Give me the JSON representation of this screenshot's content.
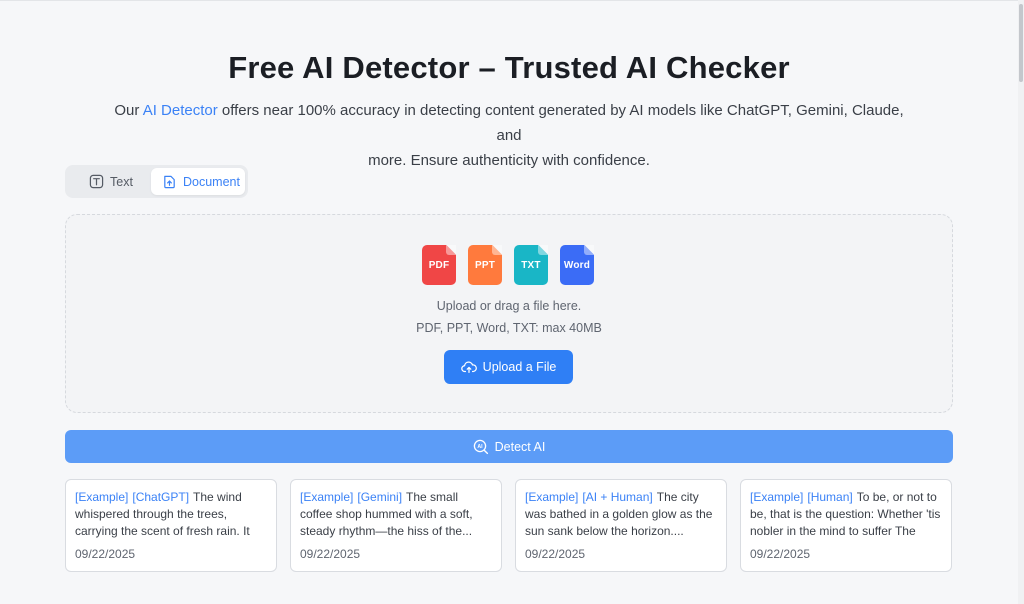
{
  "header": {
    "title": "Free AI Detector – Trusted AI Checker",
    "subtitle_prefix": "Our ",
    "subtitle_link": "AI Detector",
    "subtitle_line1_rest": " offers near 100% accuracy in detecting content generated by AI models like ChatGPT, Gemini, Claude, and",
    "subtitle_line2": "more. Ensure authenticity with confidence."
  },
  "tabs": {
    "text_label": "Text",
    "document_label": "Document",
    "active": "Document"
  },
  "upload": {
    "file_types": [
      {
        "label": "PDF",
        "color": "#f04646"
      },
      {
        "label": "PPT",
        "color": "#ff7a3d"
      },
      {
        "label": "TXT",
        "color": "#19b6c6"
      },
      {
        "label": "Word",
        "color": "#3b6cf6"
      }
    ],
    "hint": "Upload or drag a file here.",
    "limits": "PDF, PPT, Word, TXT: max 40MB",
    "button_label": "Upload a File"
  },
  "detect": {
    "button_label": "Detect AI",
    "icon_text": "AI"
  },
  "examples": [
    {
      "tags": [
        "[Example]",
        "[ChatGPT]"
      ],
      "text": "The wind whispered through the trees, carrying the scent of fresh rain. It was a...",
      "date": "09/22/2025"
    },
    {
      "tags": [
        "[Example]",
        "[Gemini]"
      ],
      "text": "The small coffee shop hummed with a soft, steady rhythm—the hiss of the...",
      "date": "09/22/2025"
    },
    {
      "tags": [
        "[Example]",
        "[AI + Human]"
      ],
      "text": "The city was bathed in a golden glow as the sun sank below the horizon....",
      "date": "09/22/2025"
    },
    {
      "tags": [
        "[Example]",
        "[Human]"
      ],
      "text": "To be, or not to be, that is the question: Whether 'tis nobler in the mind to suffer The slin...",
      "date": "09/22/2025"
    }
  ],
  "colors": {
    "accent": "#2f7ff5",
    "detect_button": "#5c9cf7",
    "link": "#3b82f6"
  }
}
